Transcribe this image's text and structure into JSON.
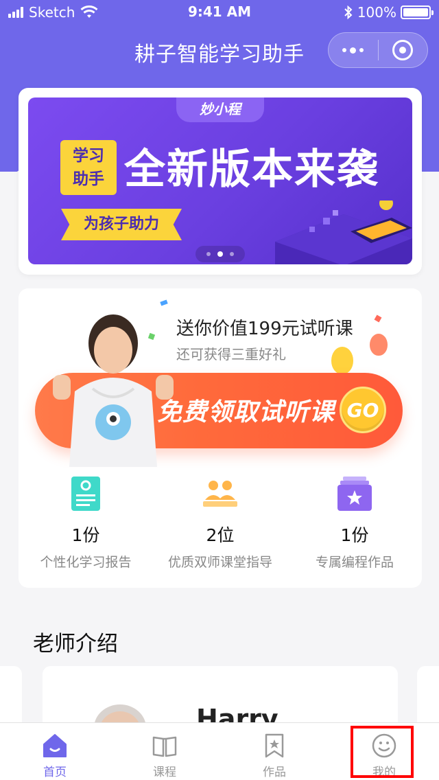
{
  "status_bar": {
    "carrier": "Sketch",
    "time": "9:41 AM",
    "battery": "100%",
    "battery_level": 1.0
  },
  "nav": {
    "title": "耕子智能学习助手",
    "more_icon": "more-dots-icon",
    "close_icon": "target-icon"
  },
  "banner": {
    "brand": "妙小程",
    "badge": [
      "学习",
      "助手"
    ],
    "headline": "全新版本来袭",
    "ribbon": "为孩子助力",
    "pages": 3,
    "active_page": 2,
    "colors": {
      "accent": "#6f67ea",
      "yellow": "#fbd43b"
    }
  },
  "promo": {
    "title": "送你价值199元试听课",
    "subtitle": "还可获得三重好礼",
    "cta_label": "免费领取试听课",
    "go_label": "GO",
    "features": [
      {
        "icon": "report-icon",
        "count": "1份",
        "label": "个性化学习报告"
      },
      {
        "icon": "teachers-icon",
        "count": "2位",
        "label": "优质双师课堂指导"
      },
      {
        "icon": "star-works-icon",
        "count": "1份",
        "label": "专属编程作品"
      }
    ]
  },
  "teachers": {
    "section_title": "老师介绍",
    "first_name": "Harry"
  },
  "tabbar": {
    "items": [
      {
        "label": "首页",
        "icon": "home-icon",
        "active": true
      },
      {
        "label": "课程",
        "icon": "book-icon",
        "active": false
      },
      {
        "label": "作品",
        "icon": "bookmark-icon",
        "active": false
      },
      {
        "label": "我的",
        "icon": "profile-icon",
        "active": false
      }
    ]
  }
}
